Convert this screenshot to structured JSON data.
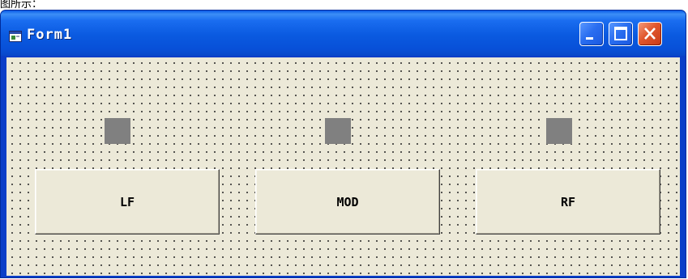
{
  "caption_fragment": "图所示：",
  "window": {
    "title": "Form1",
    "controls": {
      "minimize": "minimize",
      "maximize": "maximize",
      "close": "close"
    }
  },
  "form": {
    "shapes": [
      {
        "name": "shape-left",
        "color": "#808080"
      },
      {
        "name": "shape-middle",
        "color": "#808080"
      },
      {
        "name": "shape-right",
        "color": "#808080"
      }
    ],
    "buttons": [
      {
        "label": "LF"
      },
      {
        "label": "MOD"
      },
      {
        "label": "RF"
      }
    ]
  },
  "colors": {
    "titlebar": "#0a5ae0",
    "client_bg": "#ece9d8",
    "grid_dot": "#2b2b2b",
    "close_button": "#e0562c"
  }
}
